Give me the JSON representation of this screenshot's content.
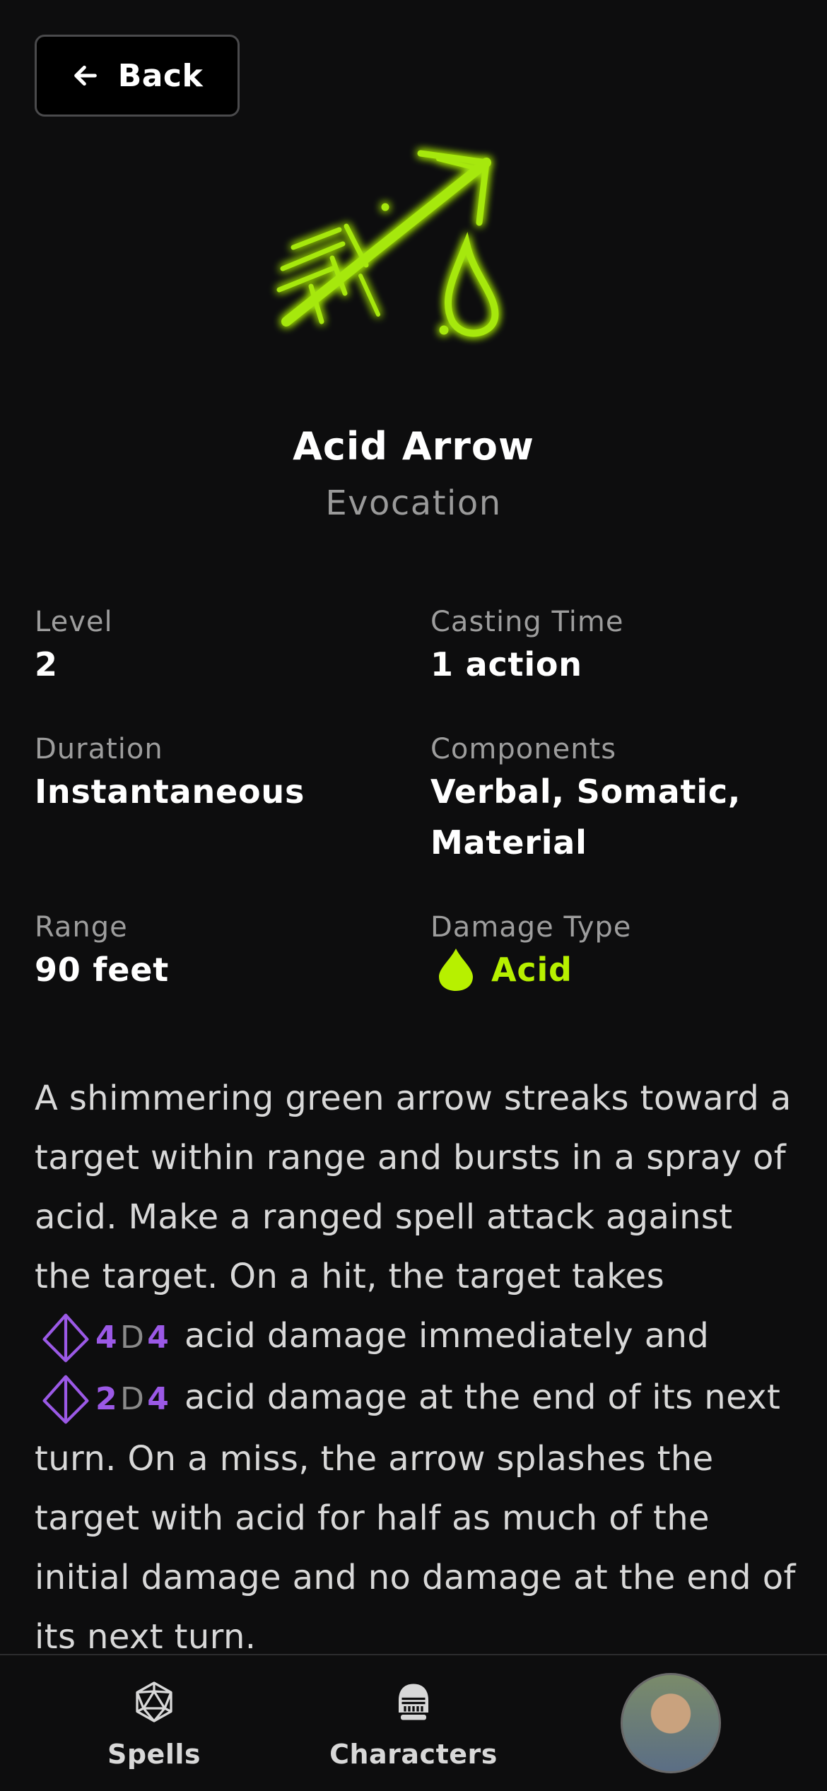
{
  "nav": {
    "back_label": "Back"
  },
  "spell": {
    "name": "Acid Arrow",
    "school": "Evocation",
    "icon": "acid-arrow-icon",
    "accent_color": "#b7f000"
  },
  "stats": {
    "level": {
      "label": "Level",
      "value": "2"
    },
    "casting_time": {
      "label": "Casting Time",
      "value": "1 action"
    },
    "duration": {
      "label": "Duration",
      "value": "Instantaneous"
    },
    "components": {
      "label": "Components",
      "value": "Verbal, Somatic, Material"
    },
    "range": {
      "label": "Range",
      "value": "90 feet"
    },
    "damage_type": {
      "label": "Damage Type",
      "value": "Acid",
      "icon": "acid-drop-icon"
    }
  },
  "description": {
    "part1": "A shimmering green arrow streaks toward a target within range and bursts in a spray of acid. Make a ranged spell attack against the target. On a hit, the target takes ",
    "dice1": {
      "count": "4",
      "d": "D",
      "sides": "4"
    },
    "part2": " acid damage immediately and ",
    "dice2": {
      "count": "2",
      "d": "D",
      "sides": "4"
    },
    "part3": " acid damage at the end of its next turn. On a miss, the arrow splashes the target with acid for half as much of the initial damage and no damage at the end of its next turn.",
    "dice_color": "#9b59e6"
  },
  "tabbar": {
    "tabs": [
      {
        "label": "Spells",
        "icon": "d20-icon"
      },
      {
        "label": "Characters",
        "icon": "knight-helmet-icon"
      }
    ],
    "profile": {
      "icon": "avatar"
    }
  }
}
